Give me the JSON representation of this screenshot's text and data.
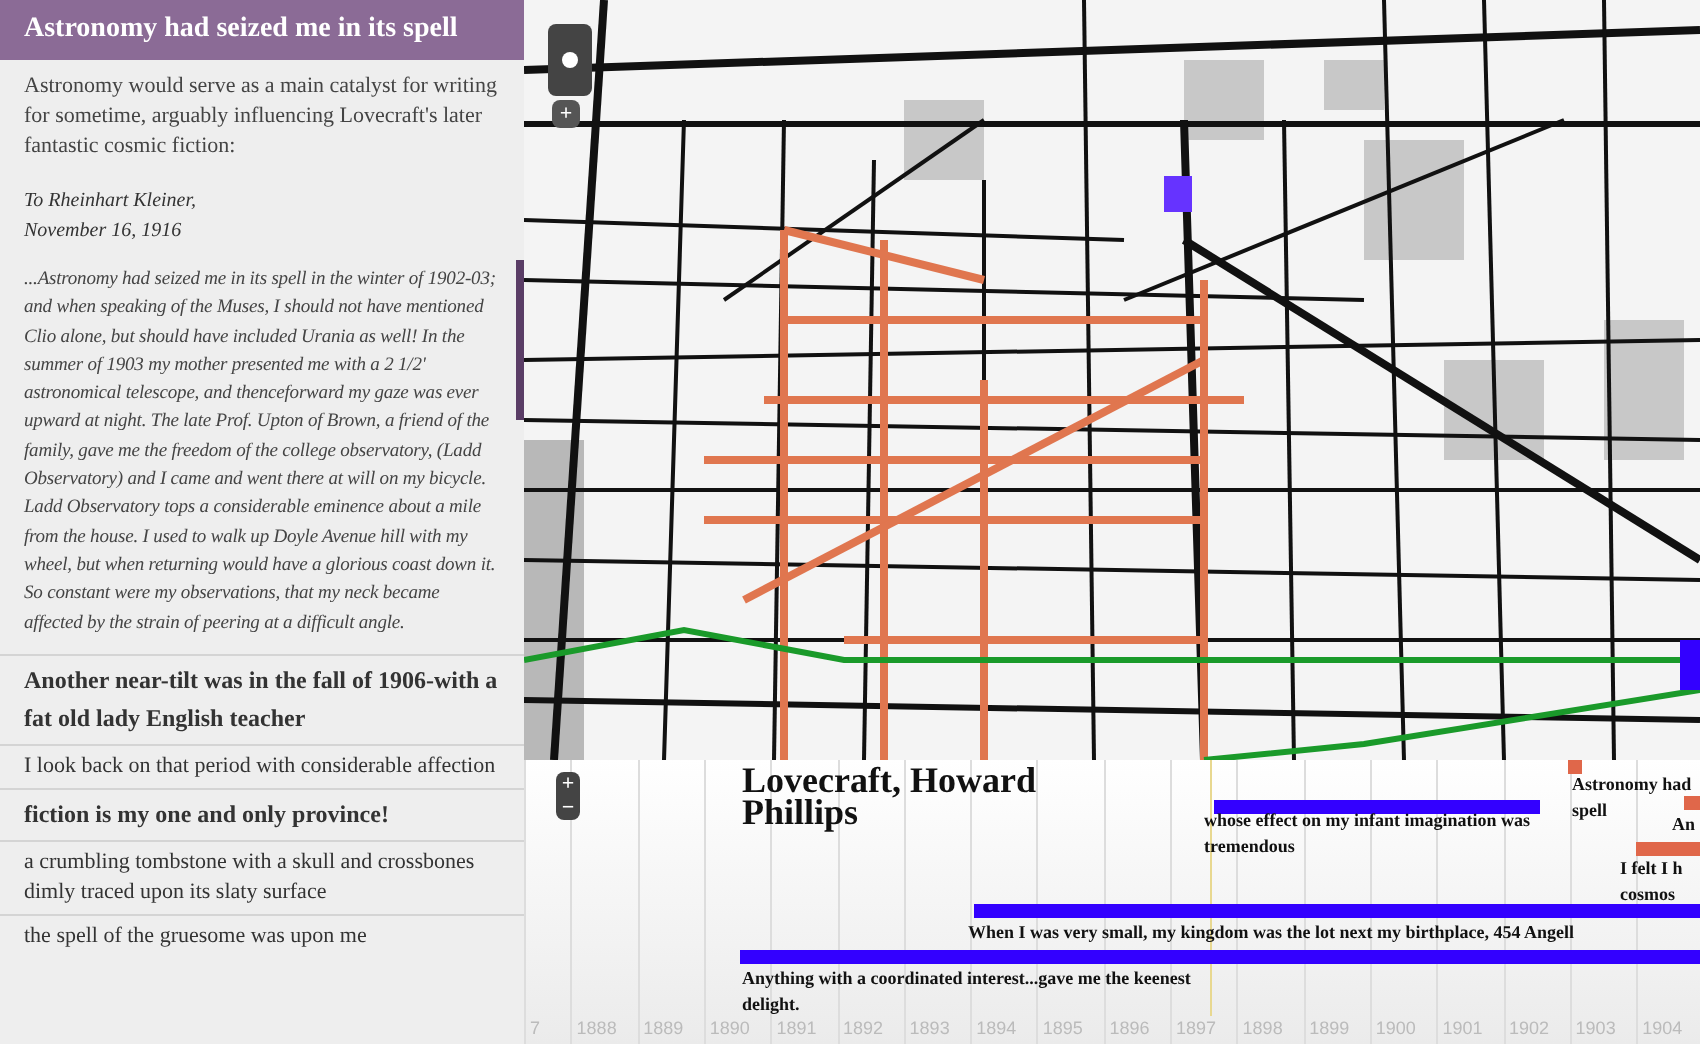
{
  "story_panel": {
    "title": "Astronomy had seized me in its spell",
    "intro": "Astronomy would serve as a main catalyst for writing for sometime, arguably influencing Lovecraft's later fantastic cosmic fiction:",
    "letter_lines": [
      "To Rheinhart Kleiner,",
      "November 16, 1916"
    ],
    "quote": "...Astronomy had seized me in its spell in the winter of 1902-03; and when speaking of the Muses, I should not have mentioned Clio alone, but should have included Urania as well! In the summer of 1903 my mother presented me with a 2 1/2' astronomical telescope, and thenceforward my gaze was ever upward at night. The late Prof. Upton of Brown, a friend of the family, gave me the freedom of the college observatory, (Ladd Observatory) and I came and went there at will on my bicycle. Ladd Observatory tops a considerable eminence about a mile from the house. I used to walk up Doyle Avenue hill with my wheel, but when returning would have a glorious coast down it. So constant were my observations, that my neck became affected by the strain of peering at a difficult angle.",
    "entries": [
      {
        "text": "Another near-tilt was in the fall of 1906-with a fat old lady English teacher",
        "bold": true
      },
      {
        "text": "I look back on that period with considerable affection",
        "bold": false
      },
      {
        "text": "fiction is my one and only province!",
        "bold": true
      },
      {
        "text": "a crumbling tombstone with a skull and crossbones dimly traced upon its slaty surface",
        "bold": false
      },
      {
        "text": "the spell of the gruesome was upon me",
        "bold": false
      }
    ]
  },
  "map": {
    "zoom_in": "+"
  },
  "timeline": {
    "title": "Lovecraft, Howard Phillips",
    "zoom_in": "+",
    "zoom_out": "−",
    "years": [
      "7",
      "1888",
      "1889",
      "1890",
      "1891",
      "1892",
      "1893",
      "1894",
      "1895",
      "1896",
      "1897",
      "1898",
      "1899",
      "1900",
      "1901",
      "1902",
      "1903",
      "1904"
    ],
    "events": [
      {
        "lines": [
          "Astronomy had",
          "spell"
        ],
        "color": "#e0674a"
      },
      {
        "lines": [
          "whose effect on my infant imagination was tremendous"
        ],
        "color": "#3300ff"
      },
      {
        "lines": [
          "An"
        ],
        "color": "#e0674a"
      },
      {
        "lines": [
          "I felt I h",
          "cosmos"
        ],
        "color": "#e0674a"
      },
      {
        "lines": [
          "When I was very small, my kingdom was the lot next my birthplace, 454 Angell"
        ],
        "color": "#3300ff"
      },
      {
        "lines": [
          "Anything with a coordinated interest...gave me the keenest delight."
        ],
        "color": "#3300ff"
      }
    ]
  }
}
